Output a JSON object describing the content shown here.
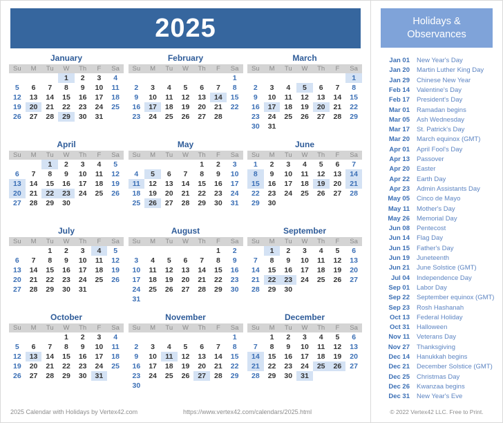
{
  "header": {
    "year": "2025",
    "banner_color": "#36669e"
  },
  "holidays_panel": {
    "title_line1": "Holidays &",
    "title_line2": "Observances",
    "banner_color": "#7fa3d9",
    "items": [
      {
        "date": "Jan 01",
        "name": "New Year's Day"
      },
      {
        "date": "Jan 20",
        "name": "Martin Luther King Day"
      },
      {
        "date": "Jan 29",
        "name": "Chinese New Year"
      },
      {
        "date": "Feb 14",
        "name": "Valentine's Day"
      },
      {
        "date": "Feb 17",
        "name": "President's Day"
      },
      {
        "date": "Mar 01",
        "name": "Ramadan begins"
      },
      {
        "date": "Mar 05",
        "name": "Ash Wednesday"
      },
      {
        "date": "Mar 17",
        "name": "St. Patrick's Day"
      },
      {
        "date": "Mar 20",
        "name": "March equinox (GMT)"
      },
      {
        "date": "Apr 01",
        "name": "April Fool's Day"
      },
      {
        "date": "Apr 13",
        "name": "Passover"
      },
      {
        "date": "Apr 20",
        "name": "Easter"
      },
      {
        "date": "Apr 22",
        "name": "Earth Day"
      },
      {
        "date": "Apr 23",
        "name": "Admin Assistants Day"
      },
      {
        "date": "May 05",
        "name": "Cinco de Mayo"
      },
      {
        "date": "May 11",
        "name": "Mother's Day"
      },
      {
        "date": "May 26",
        "name": "Memorial Day"
      },
      {
        "date": "Jun 08",
        "name": "Pentecost"
      },
      {
        "date": "Jun 14",
        "name": "Flag Day"
      },
      {
        "date": "Jun 15",
        "name": "Father's Day"
      },
      {
        "date": "Jun 19",
        "name": "Juneteenth"
      },
      {
        "date": "Jun 21",
        "name": "June Solstice (GMT)"
      },
      {
        "date": "Jul 04",
        "name": "Independence Day"
      },
      {
        "date": "Sep 01",
        "name": "Labor Day"
      },
      {
        "date": "Sep 22",
        "name": "September equinox (GMT)"
      },
      {
        "date": "Sep 23",
        "name": "Rosh Hashanah"
      },
      {
        "date": "Oct 13",
        "name": "Federal Holiday"
      },
      {
        "date": "Oct 31",
        "name": "Halloween"
      },
      {
        "date": "Nov 11",
        "name": "Veterans Day"
      },
      {
        "date": "Nov 27",
        "name": "Thanksgiving"
      },
      {
        "date": "Dec 14",
        "name": "Hanukkah begins"
      },
      {
        "date": "Dec 21",
        "name": "December Solstice (GMT)"
      },
      {
        "date": "Dec 25",
        "name": "Christmas Day"
      },
      {
        "date": "Dec 26",
        "name": "Kwanzaa begins"
      },
      {
        "date": "Dec 31",
        "name": "New Year's Eve"
      }
    ],
    "copyright": "© 2022 Vertex42 LLC. Free to Print."
  },
  "calendar": {
    "weekday_headers": [
      "Su",
      "M",
      "Tu",
      "W",
      "Th",
      "F",
      "Sa"
    ],
    "highlight_color": "#d4e2f4",
    "weekend_color": "#3b6fb5",
    "months": [
      {
        "name": "January",
        "days": 31,
        "start": 3,
        "highlights": [
          1,
          20,
          29
        ]
      },
      {
        "name": "February",
        "days": 28,
        "start": 6,
        "highlights": [
          14,
          17
        ]
      },
      {
        "name": "March",
        "days": 31,
        "start": 6,
        "highlights": [
          1,
          5,
          17,
          20
        ]
      },
      {
        "name": "April",
        "days": 30,
        "start": 2,
        "highlights": [
          1,
          13,
          20,
          22,
          23
        ]
      },
      {
        "name": "May",
        "days": 31,
        "start": 4,
        "highlights": [
          5,
          11,
          26
        ]
      },
      {
        "name": "June",
        "days": 30,
        "start": 0,
        "highlights": [
          8,
          14,
          15,
          19,
          21
        ]
      },
      {
        "name": "July",
        "days": 31,
        "start": 2,
        "highlights": [
          4
        ]
      },
      {
        "name": "August",
        "days": 31,
        "start": 5,
        "highlights": []
      },
      {
        "name": "September",
        "days": 30,
        "start": 1,
        "highlights": [
          1,
          22,
          23
        ]
      },
      {
        "name": "October",
        "days": 31,
        "start": 3,
        "highlights": [
          13,
          31
        ]
      },
      {
        "name": "November",
        "days": 30,
        "start": 6,
        "highlights": [
          11,
          27
        ]
      },
      {
        "name": "December",
        "days": 31,
        "start": 1,
        "highlights": [
          14,
          21,
          25,
          26,
          31
        ]
      }
    ]
  },
  "footer": {
    "left": "2025 Calendar with Holidays by Vertex42.com",
    "right": "https://www.vertex42.com/calendars/2025.html"
  }
}
